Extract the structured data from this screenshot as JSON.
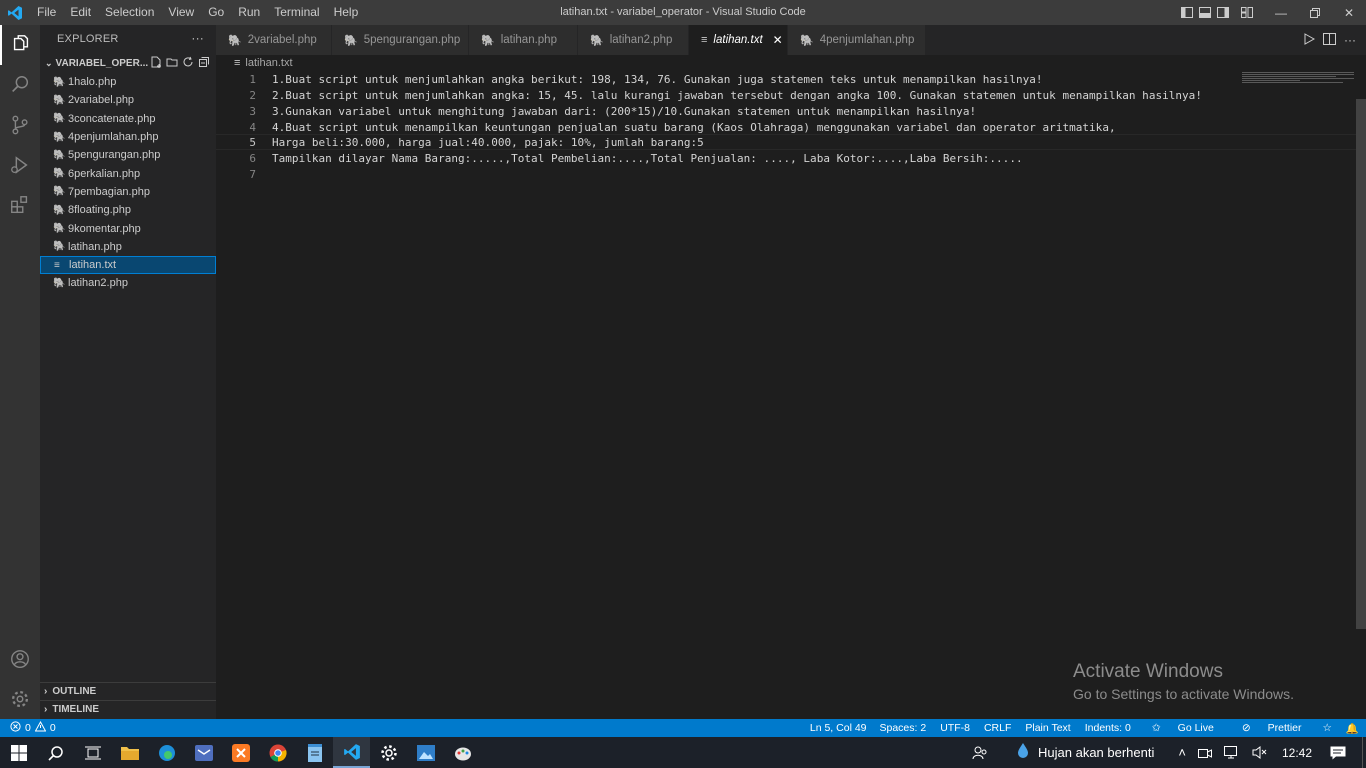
{
  "window": {
    "title": "latihan.txt - variabel_operator - Visual Studio Code",
    "menu": [
      "File",
      "Edit",
      "Selection",
      "View",
      "Go",
      "Run",
      "Terminal",
      "Help"
    ]
  },
  "sidebar": {
    "header": "EXPLORER",
    "folder": "VARIABEL_OPER...",
    "files": [
      "1halo.php",
      "2variabel.php",
      "3concatenate.php",
      "4penjumlahan.php",
      "5pengurangan.php",
      "6perkalian.php",
      "7pembagian.php",
      "8floating.php",
      "9komentar.php",
      "latihan.php",
      "latihan.txt",
      "latihan2.php"
    ],
    "selected_file": "latihan.txt",
    "outline": "OUTLINE",
    "timeline": "TIMELINE"
  },
  "tabs": [
    {
      "label": "2variabel.php",
      "active": false
    },
    {
      "label": "5pengurangan.php",
      "active": false
    },
    {
      "label": "latihan.php",
      "active": false
    },
    {
      "label": "latihan2.php",
      "active": false
    },
    {
      "label": "latihan.txt",
      "active": true
    },
    {
      "label": "4penjumlahan.php",
      "active": false
    }
  ],
  "breadcrumb": "latihan.txt",
  "editor": {
    "current_line": 5,
    "lines": [
      {
        "n": "1",
        "text": "1.Buat script untuk menjumlahkan angka berikut: 198, 134, 76. Gunakan juga statemen teks untuk menampilkan hasilnya!"
      },
      {
        "n": "2",
        "text": "2.Buat script untuk menjumlahkan angka: 15, 45. lalu kurangi jawaban tersebut dengan angka 100. Gunakan statemen untuk menampilkan hasilnya!"
      },
      {
        "n": "3",
        "text": "3.Gunakan variabel untuk menghitung jawaban dari: (200*15)/10.Gunakan statemen untuk menampilkan hasilnya!"
      },
      {
        "n": "4",
        "text": "4.Buat script untuk menampilkan keuntungan penjualan suatu barang (Kaos Olahraga) menggunakan variabel dan operator aritmatika,"
      },
      {
        "n": "5",
        "text": "Harga beli:30.000, harga jual:40.000, pajak: 10%, jumlah barang:5"
      },
      {
        "n": "6",
        "text": "Tampilkan dilayar Nama Barang:.....,Total Pembelian:....,Total Penjualan: ...., Laba Kotor:....,Laba Bersih:....."
      },
      {
        "n": "7",
        "text": ""
      }
    ]
  },
  "watermark": {
    "line1": "Activate Windows",
    "line2": "Go to Settings to activate Windows."
  },
  "statusbar": {
    "errors": "0",
    "warnings": "0",
    "position": "Ln 5, Col 49",
    "spaces": "Spaces: 2",
    "encoding": "UTF-8",
    "eol": "CRLF",
    "language": "Plain Text",
    "indents": "Indents: 0",
    "golive": "Go Live",
    "prettier": "Prettier"
  },
  "taskbar": {
    "weather": "Hujan akan berhenti",
    "time": "12:42"
  },
  "colors": {
    "accent": "#007acc",
    "php_icon": "#a074c4"
  }
}
